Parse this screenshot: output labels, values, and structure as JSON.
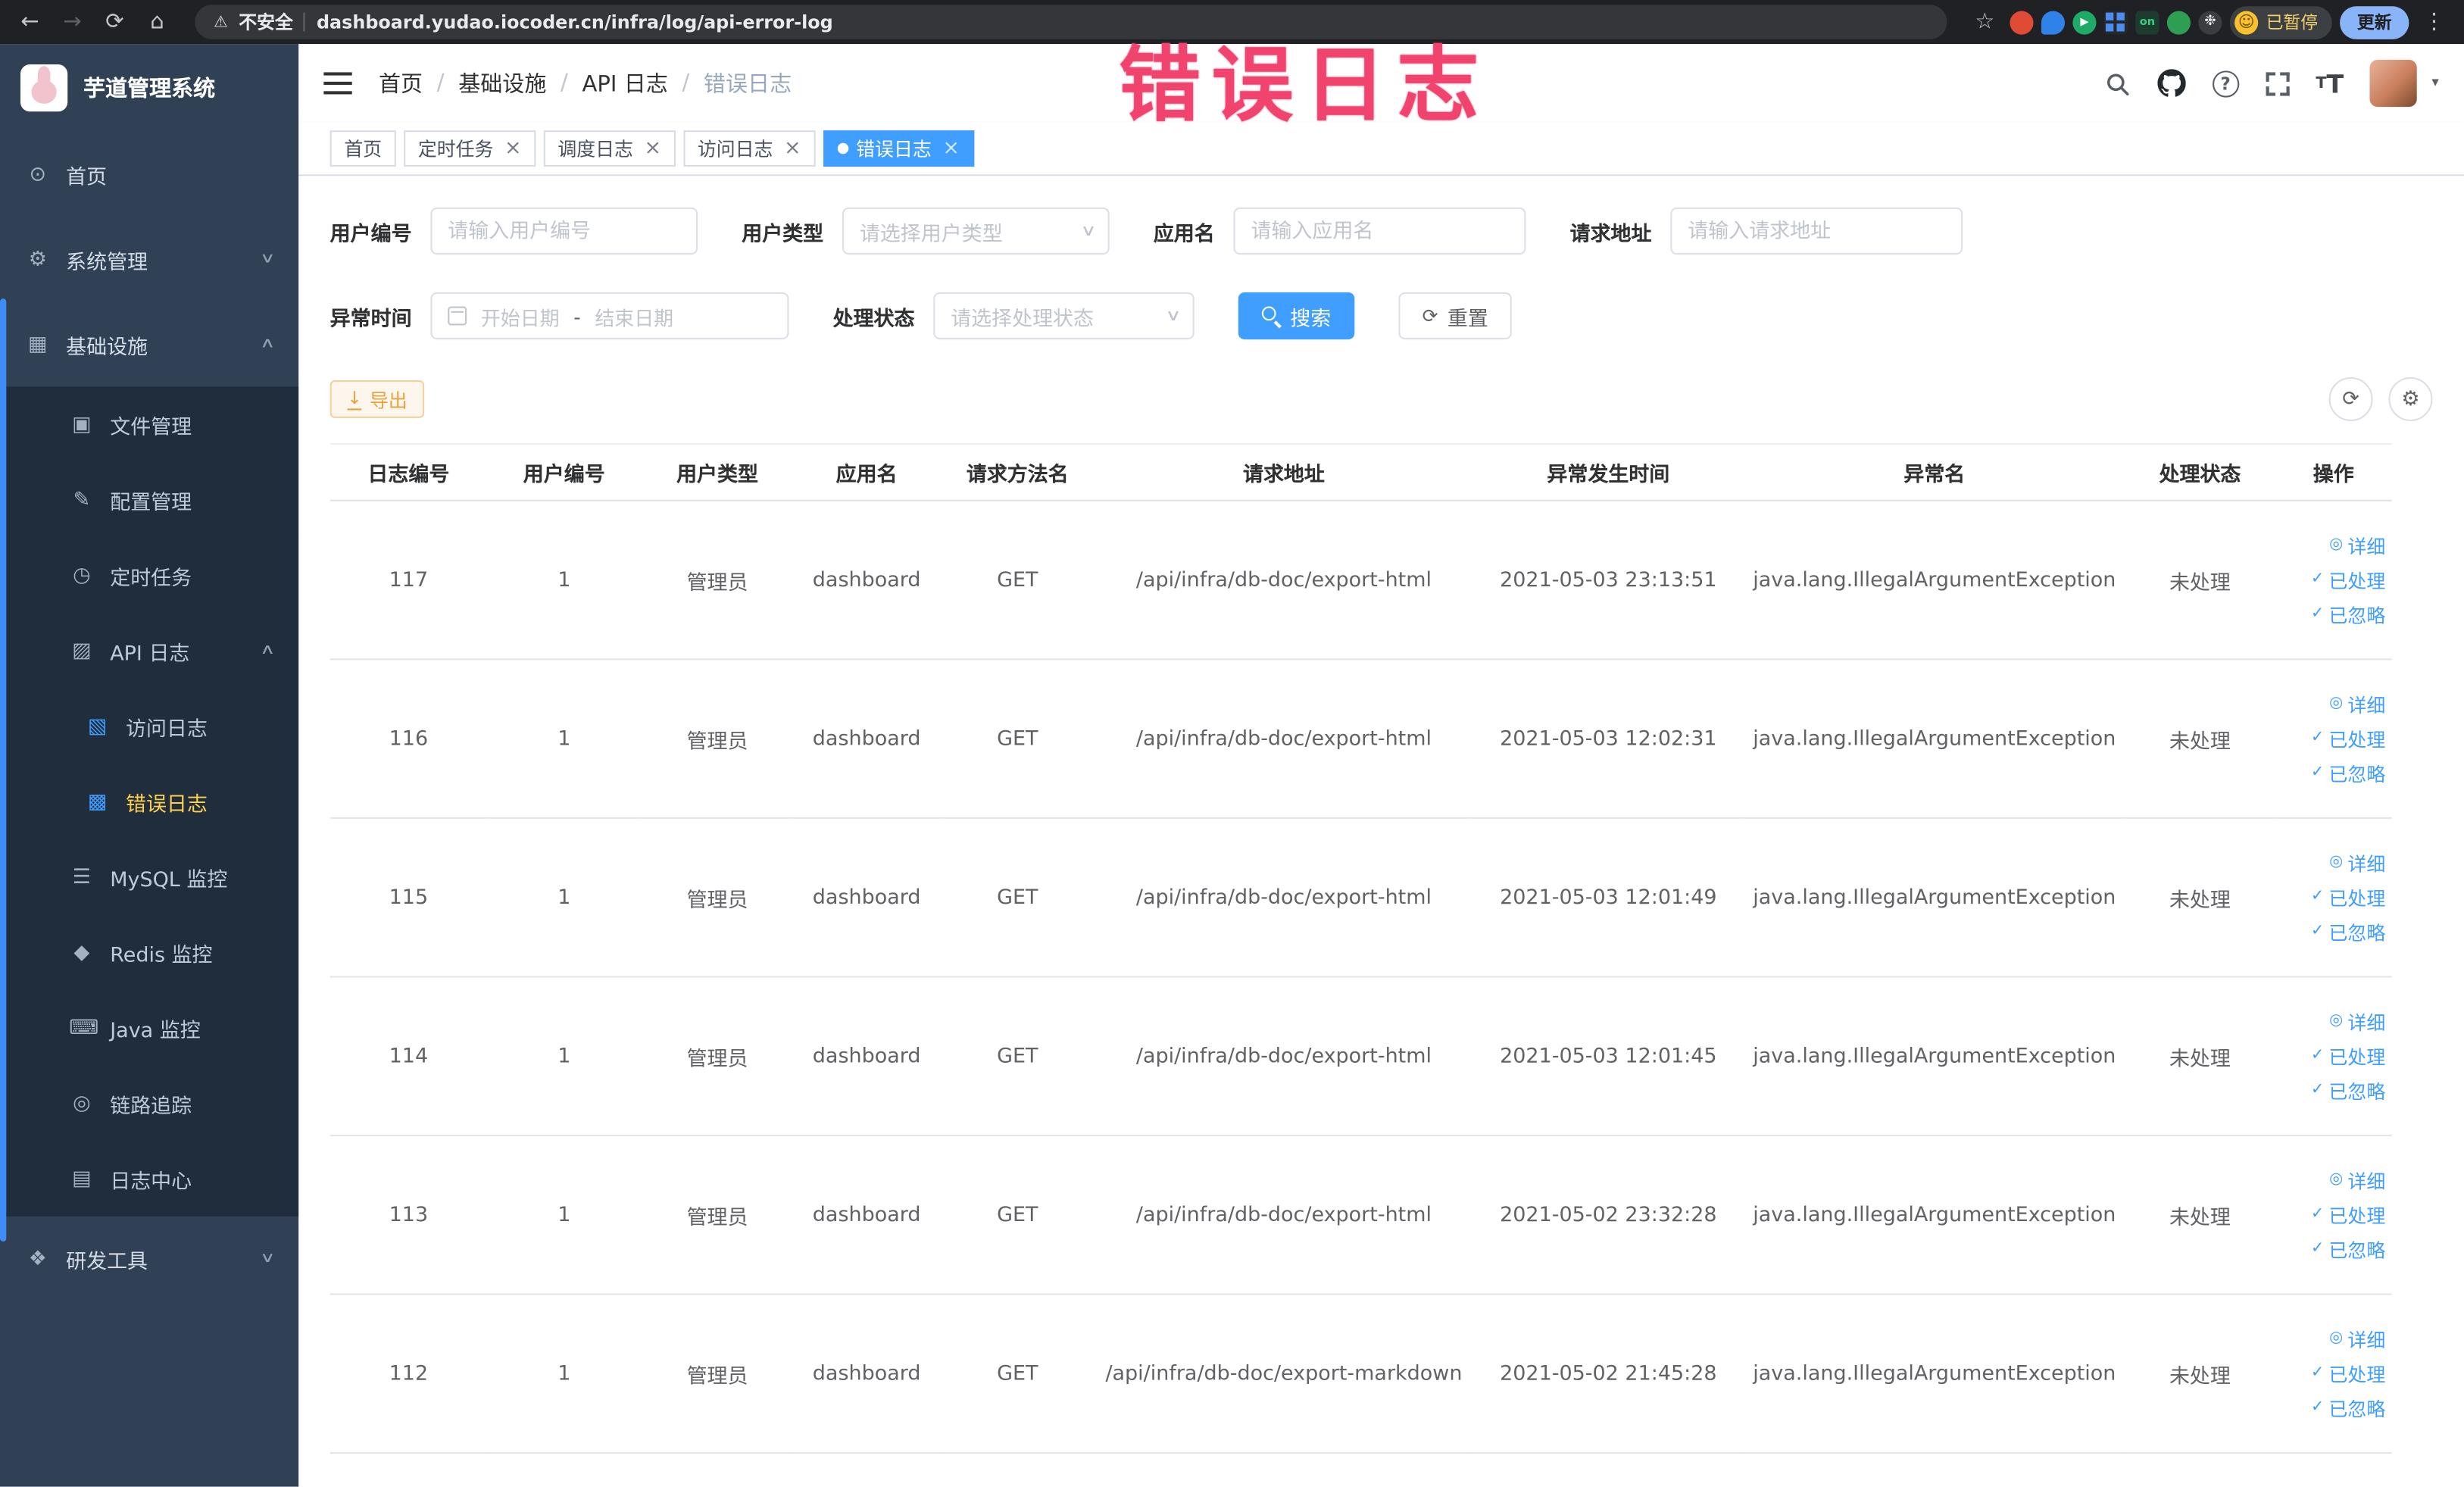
{
  "browser": {
    "security_label": "不安全",
    "url": "dashboard.yudao.iocoder.cn/infra/log/api-error-log",
    "paused_label": "已暂停",
    "update_label": "更新"
  },
  "annotation": {
    "text": "错误日志"
  },
  "colors": {
    "accent": "#409eff",
    "sidebar_bg": "#304156",
    "submenu_bg": "#1f2d3d",
    "active_menu_text": "#ffd04b",
    "warning": "#e6a23c",
    "annotation": "#f0436e"
  },
  "sidebar": {
    "logo_title": "芋道管理系统",
    "items": [
      {
        "key": "home",
        "label": "首页",
        "icon": "gauge",
        "level": 1
      },
      {
        "key": "system",
        "label": "系统管理",
        "icon": "gear",
        "level": 1,
        "chevron": "down"
      },
      {
        "key": "infra",
        "label": "基础设施",
        "icon": "infra",
        "level": 1,
        "chevron": "up"
      },
      {
        "key": "file",
        "label": "文件管理",
        "icon": "file",
        "level": 2
      },
      {
        "key": "config",
        "label": "配置管理",
        "icon": "config",
        "level": 2
      },
      {
        "key": "job",
        "label": "定时任务",
        "icon": "timer",
        "level": 2
      },
      {
        "key": "api-log",
        "label": "API 日志",
        "icon": "api",
        "level": 2,
        "chevron": "up"
      },
      {
        "key": "access-log",
        "label": "访问日志",
        "icon": "access",
        "level": 3
      },
      {
        "key": "error-log",
        "label": "错误日志",
        "icon": "error",
        "level": 3,
        "active": true
      },
      {
        "key": "mysql",
        "label": "MySQL 监控",
        "icon": "mysql",
        "level": 2
      },
      {
        "key": "redis",
        "label": "Redis 监控",
        "icon": "redis",
        "level": 2
      },
      {
        "key": "java",
        "label": "Java 监控",
        "icon": "java",
        "level": 2
      },
      {
        "key": "trace",
        "label": "链路追踪",
        "icon": "trace",
        "level": 2
      },
      {
        "key": "log-center",
        "label": "日志中心",
        "icon": "logcenter",
        "level": 2
      },
      {
        "key": "dev-tools",
        "label": "研发工具",
        "icon": "tools",
        "level": 1,
        "chevron": "down"
      }
    ]
  },
  "header": {
    "breadcrumb": [
      "首页",
      "基础设施",
      "API 日志",
      "错误日志"
    ]
  },
  "tabs": [
    {
      "key": "home",
      "label": "首页",
      "closable": false,
      "active": false
    },
    {
      "key": "cron-job",
      "label": "定时任务",
      "closable": true,
      "active": false
    },
    {
      "key": "job-log",
      "label": "调度日志",
      "closable": true,
      "active": false
    },
    {
      "key": "access-log",
      "label": "访问日志",
      "closable": true,
      "active": false
    },
    {
      "key": "error-log",
      "label": "错误日志",
      "closable": true,
      "active": true
    }
  ],
  "filters": {
    "user_id": {
      "label": "用户编号",
      "placeholder": "请输入用户编号"
    },
    "user_type": {
      "label": "用户类型",
      "placeholder": "请选择用户类型"
    },
    "app_name": {
      "label": "应用名",
      "placeholder": "请输入应用名"
    },
    "request_url": {
      "label": "请求地址",
      "placeholder": "请输入请求地址"
    },
    "exception_time": {
      "label": "异常时间",
      "start_placeholder": "开始日期",
      "separator": "-",
      "end_placeholder": "结束日期"
    },
    "process_status": {
      "label": "处理状态",
      "placeholder": "请选择处理状态"
    },
    "search_label": "搜索",
    "reset_label": "重置"
  },
  "toolbar": {
    "export_label": "导出"
  },
  "table": {
    "columns": [
      "日志编号",
      "用户编号",
      "用户类型",
      "应用名",
      "请求方法名",
      "请求地址",
      "异常发生时间",
      "异常名",
      "处理状态",
      "操作"
    ],
    "actions": [
      "详细",
      "已处理",
      "已忽略"
    ],
    "rows": [
      {
        "id": "117",
        "user_id": "1",
        "user_type": "管理员",
        "app": "dashboard",
        "method": "GET",
        "url": "/api/infra/db-doc/export-html",
        "time": "2021-05-03 23:13:51",
        "exception": "java.lang.IllegalArgumentException",
        "status": "未处理"
      },
      {
        "id": "116",
        "user_id": "1",
        "user_type": "管理员",
        "app": "dashboard",
        "method": "GET",
        "url": "/api/infra/db-doc/export-html",
        "time": "2021-05-03 12:02:31",
        "exception": "java.lang.IllegalArgumentException",
        "status": "未处理"
      },
      {
        "id": "115",
        "user_id": "1",
        "user_type": "管理员",
        "app": "dashboard",
        "method": "GET",
        "url": "/api/infra/db-doc/export-html",
        "time": "2021-05-03 12:01:49",
        "exception": "java.lang.IllegalArgumentException",
        "status": "未处理"
      },
      {
        "id": "114",
        "user_id": "1",
        "user_type": "管理员",
        "app": "dashboard",
        "method": "GET",
        "url": "/api/infra/db-doc/export-html",
        "time": "2021-05-03 12:01:45",
        "exception": "java.lang.IllegalArgumentException",
        "status": "未处理"
      },
      {
        "id": "113",
        "user_id": "1",
        "user_type": "管理员",
        "app": "dashboard",
        "method": "GET",
        "url": "/api/infra/db-doc/export-html",
        "time": "2021-05-02 23:32:28",
        "exception": "java.lang.IllegalArgumentException",
        "status": "未处理"
      },
      {
        "id": "112",
        "user_id": "1",
        "user_type": "管理员",
        "app": "dashboard",
        "method": "GET",
        "url": "/api/infra/db-doc/export-markdown",
        "time": "2021-05-02 21:45:28",
        "exception": "java.lang.IllegalArgumentException",
        "status": "未处理"
      }
    ]
  }
}
